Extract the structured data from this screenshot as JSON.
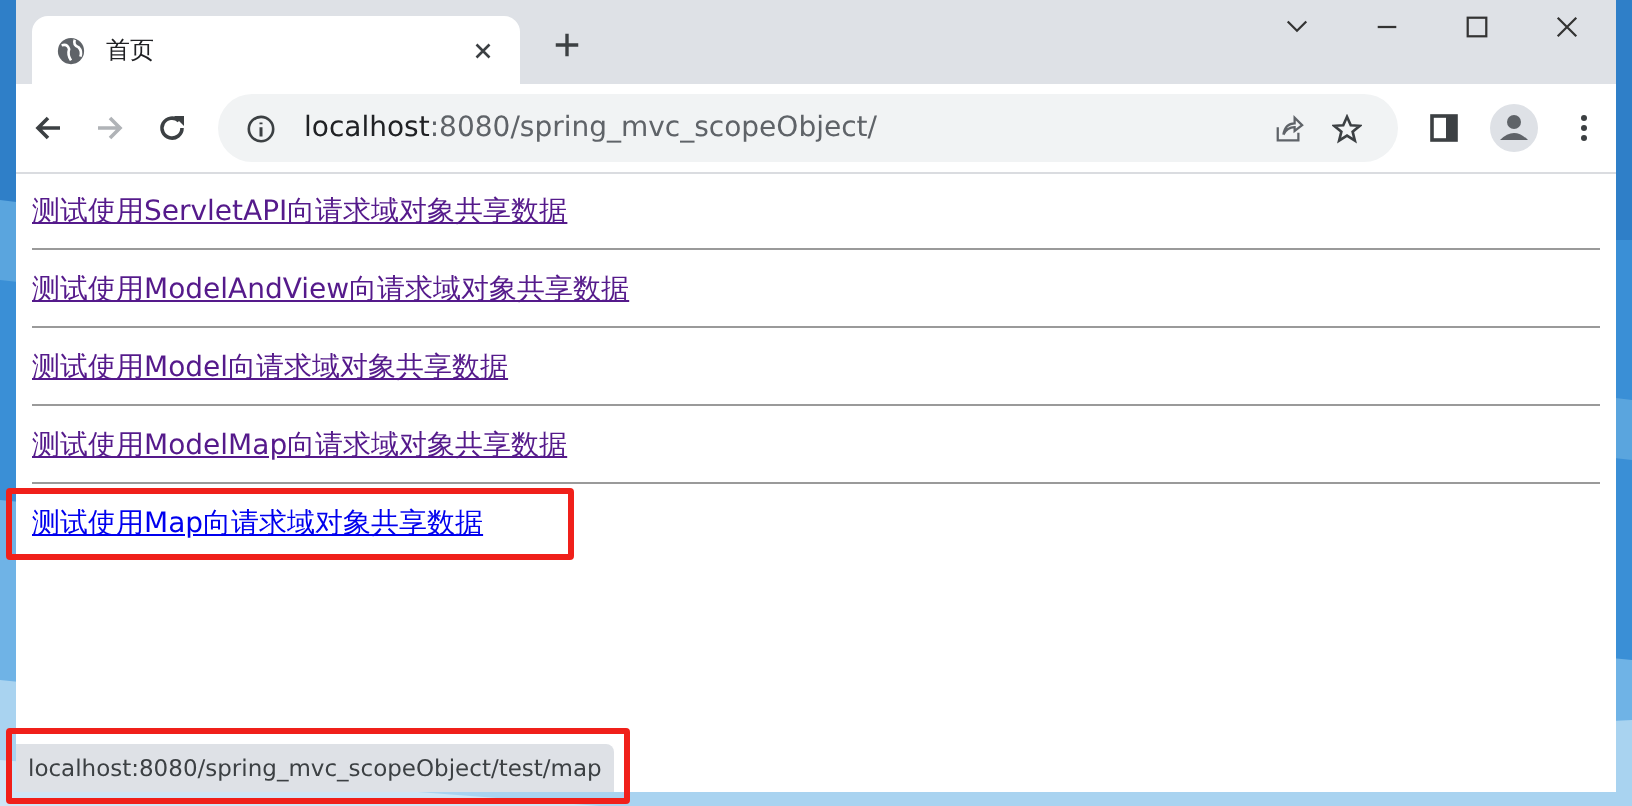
{
  "tab": {
    "title": "首页"
  },
  "address_bar": {
    "host": "localhost",
    "path": ":8080/spring_mvc_scopeObject/"
  },
  "links": [
    {
      "text": "测试使用ServletAPI向请求域对象共享数据",
      "visited": true,
      "highlighted": false
    },
    {
      "text": "测试使用ModelAndView向请求域对象共享数据",
      "visited": true,
      "highlighted": false
    },
    {
      "text": "测试使用Model向请求域对象共享数据",
      "visited": true,
      "highlighted": false
    },
    {
      "text": "测试使用ModelMap向请求域对象共享数据",
      "visited": true,
      "highlighted": false
    },
    {
      "text": "测试使用Map向请求域对象共享数据",
      "visited": false,
      "highlighted": true
    }
  ],
  "status_bar": {
    "url": "localhost:8080/spring_mvc_scopeObject/test/map",
    "highlighted": true
  }
}
